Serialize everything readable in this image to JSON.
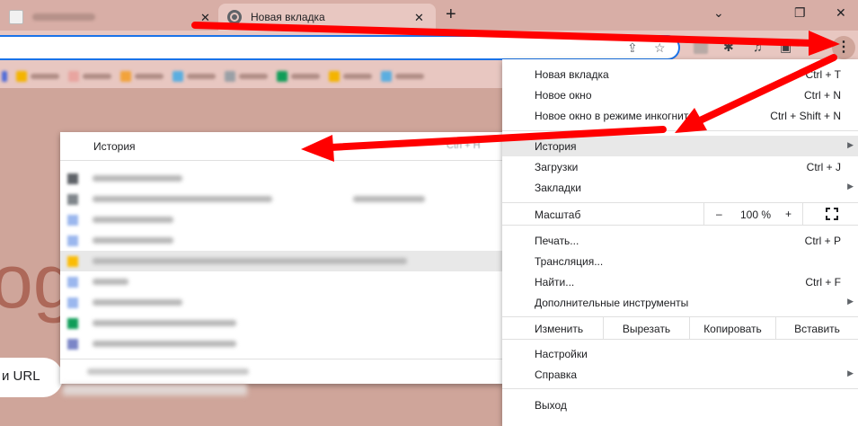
{
  "tabs": {
    "inactive_close": "✕",
    "active_title": "Новая вкладка",
    "active_close": "✕",
    "new_tab": "+"
  },
  "window": {
    "chevron": "⌄",
    "restore": "❐",
    "close": "✕"
  },
  "toolbar": {
    "share_icon": "⇪",
    "star_icon": "☆",
    "puzzle_icon": "✱",
    "music_icon": "♫",
    "side_icon": "▣",
    "menu_icon": "⋮"
  },
  "page": {
    "logo_fragment": "og",
    "search_fragment": "и URL"
  },
  "history_submenu": {
    "title": "История",
    "shortcut": "Ctrl + H"
  },
  "menu": {
    "new_tab": {
      "label": "Новая вкладка",
      "shortcut": "Ctrl + T"
    },
    "new_window": {
      "label": "Новое окно",
      "shortcut": "Ctrl + N"
    },
    "incognito": {
      "label": "Новое окно в режиме инкогнито",
      "shortcut": "Ctrl + Shift + N"
    },
    "history": {
      "label": "История"
    },
    "downloads": {
      "label": "Загрузки",
      "shortcut": "Ctrl + J"
    },
    "bookmarks": {
      "label": "Закладки"
    },
    "zoom": {
      "label": "Масштаб",
      "minus": "–",
      "value": "100 %",
      "plus": "+"
    },
    "print": {
      "label": "Печать...",
      "shortcut": "Ctrl + P"
    },
    "cast": {
      "label": "Трансляция..."
    },
    "find": {
      "label": "Найти...",
      "shortcut": "Ctrl + F"
    },
    "more_tools": {
      "label": "Дополнительные инструменты"
    },
    "edit": {
      "label": "Изменить",
      "cut": "Вырезать",
      "copy": "Копировать",
      "paste": "Вставить"
    },
    "settings": {
      "label": "Настройки"
    },
    "help": {
      "label": "Справка"
    },
    "exit": {
      "label": "Выход"
    },
    "submenu_arrow": "▶"
  },
  "colors": {
    "accent": "#1a73e8",
    "annotation_arrow": "#ff0000",
    "page_background": "#cfa59a"
  }
}
